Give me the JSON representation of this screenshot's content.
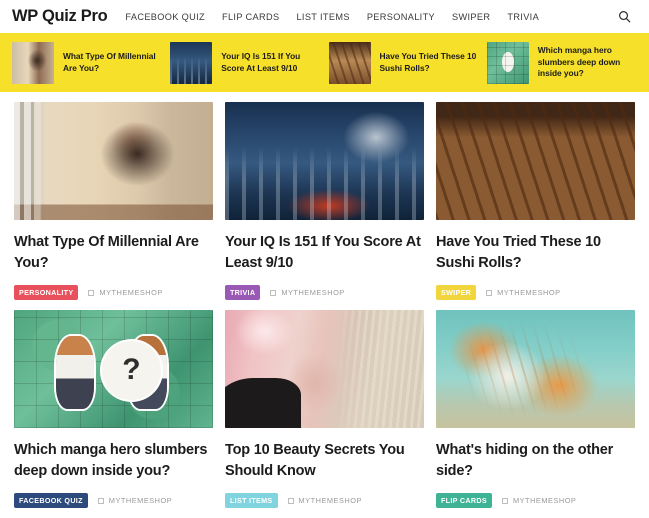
{
  "header": {
    "logo": "WP Quiz Pro",
    "nav": [
      {
        "label": "FACEBOOK QUIZ"
      },
      {
        "label": "FLIP CARDS"
      },
      {
        "label": "LIST ITEMS"
      },
      {
        "label": "PERSONALITY"
      },
      {
        "label": "SWIPER"
      },
      {
        "label": "TRIVIA"
      }
    ],
    "search_icon": "search-icon"
  },
  "ticker": {
    "background_color": "#f7e029",
    "items": [
      {
        "title": "What Type Of Millennial Are You?",
        "thumb": "cafe-woman-thumbnail"
      },
      {
        "title": "Your IQ Is 151 If You Score At Least 9/10",
        "thumb": "chess-game-thumbnail"
      },
      {
        "title": "Have You Tried These 10 Sushi Rolls?",
        "thumb": "sushi-rolls-thumbnail"
      },
      {
        "title": "Which manga hero slumbers deep down inside you?",
        "thumb": "manga-characters-thumbnail"
      }
    ]
  },
  "grid": {
    "author_label": "MYTHEMESHOP",
    "cards": [
      {
        "title": "What Type Of Millennial Are You?",
        "category": "PERSONALITY",
        "category_color": "#e8505b",
        "category_text_color": "#ffffff",
        "author": "MYTHEMESHOP",
        "image": "cafe-woman-photo"
      },
      {
        "title": "Your IQ Is 151 If You Score At Least 9/10",
        "category": "TRIVIA",
        "category_color": "#9b59b6",
        "category_text_color": "#ffffff",
        "author": "MYTHEMESHOP",
        "image": "chess-game-photo"
      },
      {
        "title": "Have You Tried These 10 Sushi Rolls?",
        "category": "SWIPER",
        "category_color": "#f2d53c",
        "category_text_color": "#ffffff",
        "author": "MYTHEMESHOP",
        "image": "sushi-rolls-photo"
      },
      {
        "title": "Which manga hero slumbers deep down inside you?",
        "category": "FACEBOOK QUIZ",
        "category_color": "#2c4a7c",
        "category_text_color": "#ffffff",
        "author": "MYTHEMESHOP",
        "image": "manga-characters-photo"
      },
      {
        "title": "Top 10 Beauty Secrets You Should Know",
        "category": "LIST ITEMS",
        "category_color": "#7fd4e0",
        "category_text_color": "#ffffff",
        "author": "MYTHEMESHOP",
        "image": "beauty-woman-photo"
      },
      {
        "title": "What's hiding on the other side?",
        "category": "FLIP CARDS",
        "category_color": "#3fb395",
        "category_text_color": "#ffffff",
        "author": "MYTHEMESHOP",
        "image": "ginger-cat-photo"
      }
    ]
  }
}
